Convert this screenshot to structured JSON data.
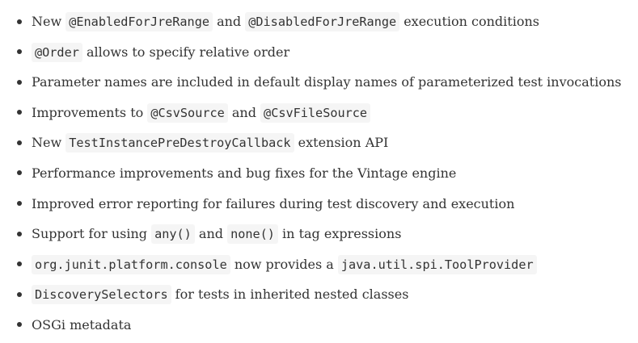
{
  "items": [
    {
      "parts": [
        {
          "text": "New ",
          "code": false
        },
        {
          "text": "@EnabledForJreRange",
          "code": true
        },
        {
          "text": " and ",
          "code": false
        },
        {
          "text": "@DisabledForJreRange",
          "code": true
        },
        {
          "text": " execution conditions",
          "code": false
        }
      ]
    },
    {
      "parts": [
        {
          "text": "@Order",
          "code": true
        },
        {
          "text": " allows to specify relative order",
          "code": false
        }
      ]
    },
    {
      "parts": [
        {
          "text": "Parameter names are included in default display names of parameterized test invocations",
          "code": false
        }
      ]
    },
    {
      "parts": [
        {
          "text": "Improvements to ",
          "code": false
        },
        {
          "text": "@CsvSource",
          "code": true
        },
        {
          "text": " and ",
          "code": false
        },
        {
          "text": "@CsvFileSource",
          "code": true
        }
      ]
    },
    {
      "parts": [
        {
          "text": "New ",
          "code": false
        },
        {
          "text": "TestInstancePreDestroyCallback",
          "code": true
        },
        {
          "text": " extension API",
          "code": false
        }
      ]
    },
    {
      "parts": [
        {
          "text": "Performance improvements and bug fixes for the Vintage engine",
          "code": false
        }
      ]
    },
    {
      "parts": [
        {
          "text": "Improved error reporting for failures during test discovery and execution",
          "code": false
        }
      ]
    },
    {
      "parts": [
        {
          "text": "Support for using ",
          "code": false
        },
        {
          "text": "any()",
          "code": true
        },
        {
          "text": " and ",
          "code": false
        },
        {
          "text": "none()",
          "code": true
        },
        {
          "text": " in tag expressions",
          "code": false
        }
      ]
    },
    {
      "parts": [
        {
          "text": "org.junit.platform.console",
          "code": true
        },
        {
          "text": " now provides a ",
          "code": false
        },
        {
          "text": "java.util.spi.ToolProvider",
          "code": true
        }
      ]
    },
    {
      "parts": [
        {
          "text": "DiscoverySelectors",
          "code": true
        },
        {
          "text": " for tests in inherited nested classes",
          "code": false
        }
      ]
    },
    {
      "parts": [
        {
          "text": "OSGi metadata",
          "code": false
        }
      ]
    }
  ]
}
